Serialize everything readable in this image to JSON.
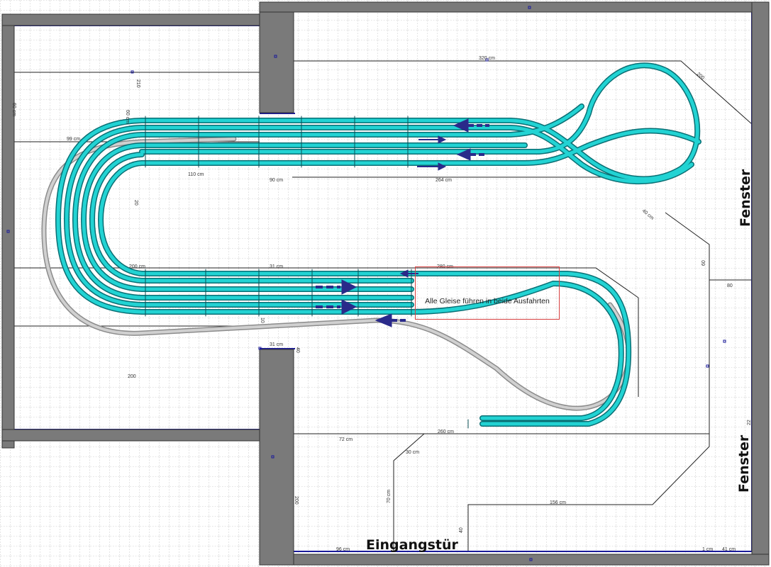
{
  "labels": {
    "window_top": "Fenster",
    "window_bottom": "Fenster",
    "entrance": "Eingangstür",
    "note": "Alle Gleise führen in beide Ausfahrten"
  },
  "dimensions": [
    "320 cm",
    "210",
    "60 cm",
    "99 cm",
    "110 cm",
    "60 cm",
    "264 cm",
    "90 cm",
    "200 cm",
    "31 cm",
    "280 cm",
    "10",
    "31 cm",
    "40",
    "200",
    "260 cm",
    "72 cm",
    "30 cm",
    "70 cm",
    "156 cm",
    "40",
    "96 cm",
    "1 cm",
    "41 cm",
    "22",
    "200",
    "20",
    "80",
    "60",
    "40 cm",
    "200"
  ],
  "colors": {
    "track": "#22d3d3",
    "track_edge": "#0a6f74",
    "track_gray": "#c8c8c8",
    "wall": "#7a7a7a",
    "grid": "#8a8a8a",
    "arrow": "#2a2a8a",
    "note_border": "#d84040"
  },
  "icons": [
    "arrow-left-icon",
    "arrow-right-icon"
  ]
}
